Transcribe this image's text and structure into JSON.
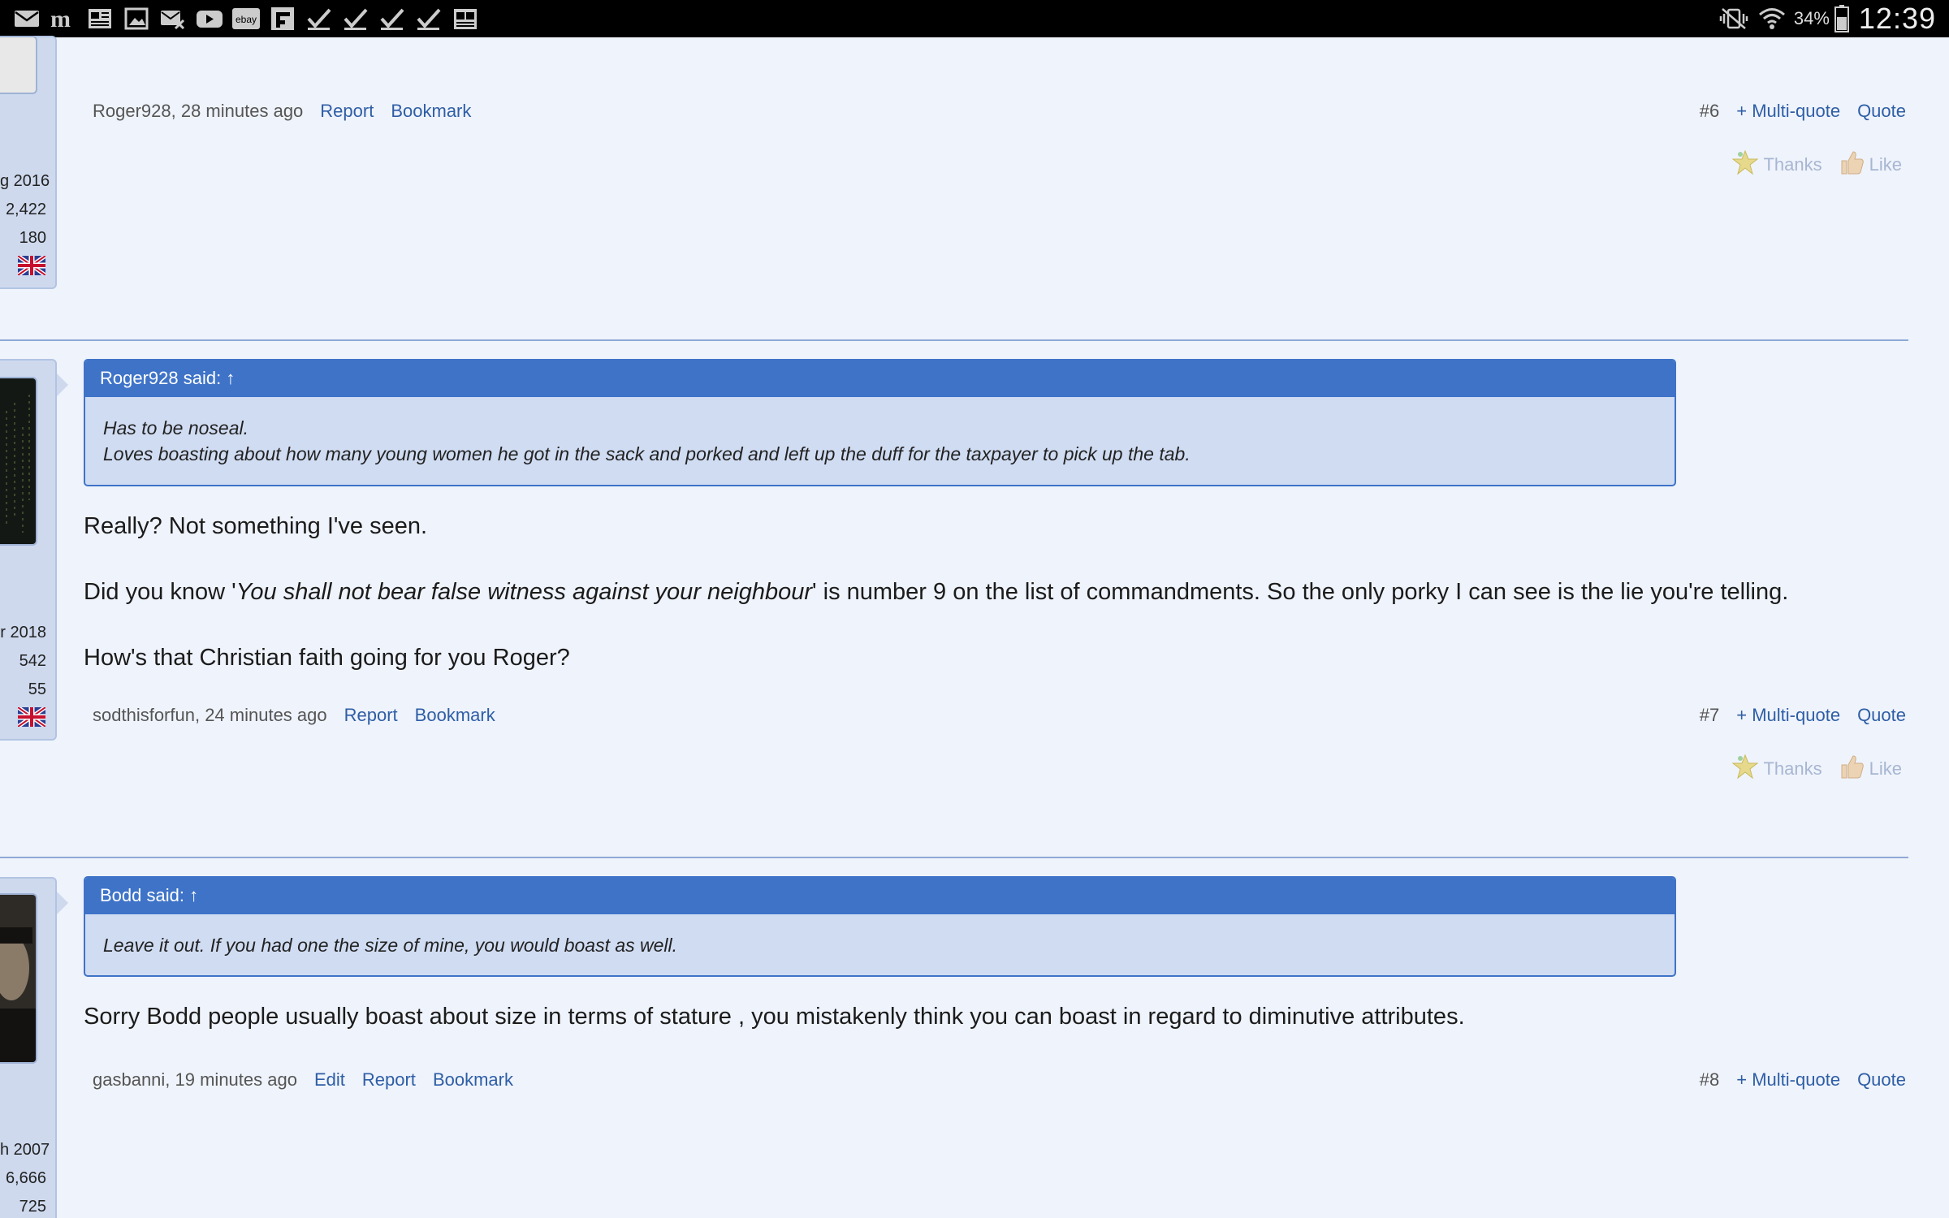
{
  "status_bar": {
    "left_icons": [
      "mail-icon",
      "medium-app-icon",
      "news-icon",
      "gallery-icon",
      "missed-call-mail-icon",
      "youtube-icon",
      "ebay-icon",
      "flipboard-icon",
      "check-icon",
      "check-icon",
      "check-icon",
      "check-icon",
      "newspaper-icon"
    ],
    "ebay_label": "ebay",
    "battery": "34%",
    "time": "12:39"
  },
  "posts": [
    {
      "user_stats": {
        "joined": "g 2016",
        "messages": "2,422",
        "likes": "180"
      },
      "meta": {
        "author_time": "Roger928, 28 minutes ago",
        "report": "Report",
        "bookmark": "Bookmark"
      },
      "post_number": "#6",
      "multiquote": "+ Multi-quote",
      "quote_label": "Quote",
      "thanks": "Thanks",
      "like": "Like"
    },
    {
      "user_stats": {
        "joined": "r 2018",
        "messages": "542",
        "likes": "55"
      },
      "quote": {
        "header": "Roger928 said: ↑",
        "line1": "Has to be noseal.",
        "line2": "Loves boasting about how many young women he got in the sack and porked and left up the duff for the taxpayer to pick up the tab."
      },
      "body": {
        "p1": "Really? Not something I've seen.",
        "p2_before": "Did you know '",
        "p2_italic": "You shall not bear false witness against your neighbour",
        "p2_after": "' is number 9 on the list of commandments. So the only porky I can see is the lie you're telling.",
        "p3": "How's that Christian faith going for you Roger?"
      },
      "meta": {
        "author_time": "sodthisforfun, 24 minutes ago",
        "report": "Report",
        "bookmark": "Bookmark"
      },
      "post_number": "#7",
      "multiquote": "+ Multi-quote",
      "quote_label": "Quote",
      "thanks": "Thanks",
      "like": "Like"
    },
    {
      "user_stats": {
        "joined": "h 2007",
        "messages": "6,666",
        "likes": "725"
      },
      "quote": {
        "header": "Bodd said: ↑",
        "line1": "Leave it out. If you had one the size of mine, you would boast as well."
      },
      "body": {
        "p1": "Sorry Bodd people usually boast about size in terms of stature , you mistakenly think you can boast in regard to diminutive attributes."
      },
      "meta": {
        "author_time": "gasbanni, 19 minutes ago",
        "edit": "Edit",
        "report": "Report",
        "bookmark": "Bookmark"
      },
      "post_number": "#8",
      "multiquote": "+ Multi-quote",
      "quote_label": "Quote"
    }
  ],
  "colors": {
    "accent": "#3e73c8",
    "link": "#2e5ea6",
    "background": "#eff3fb",
    "quote_bg": "#d0dcf2"
  }
}
